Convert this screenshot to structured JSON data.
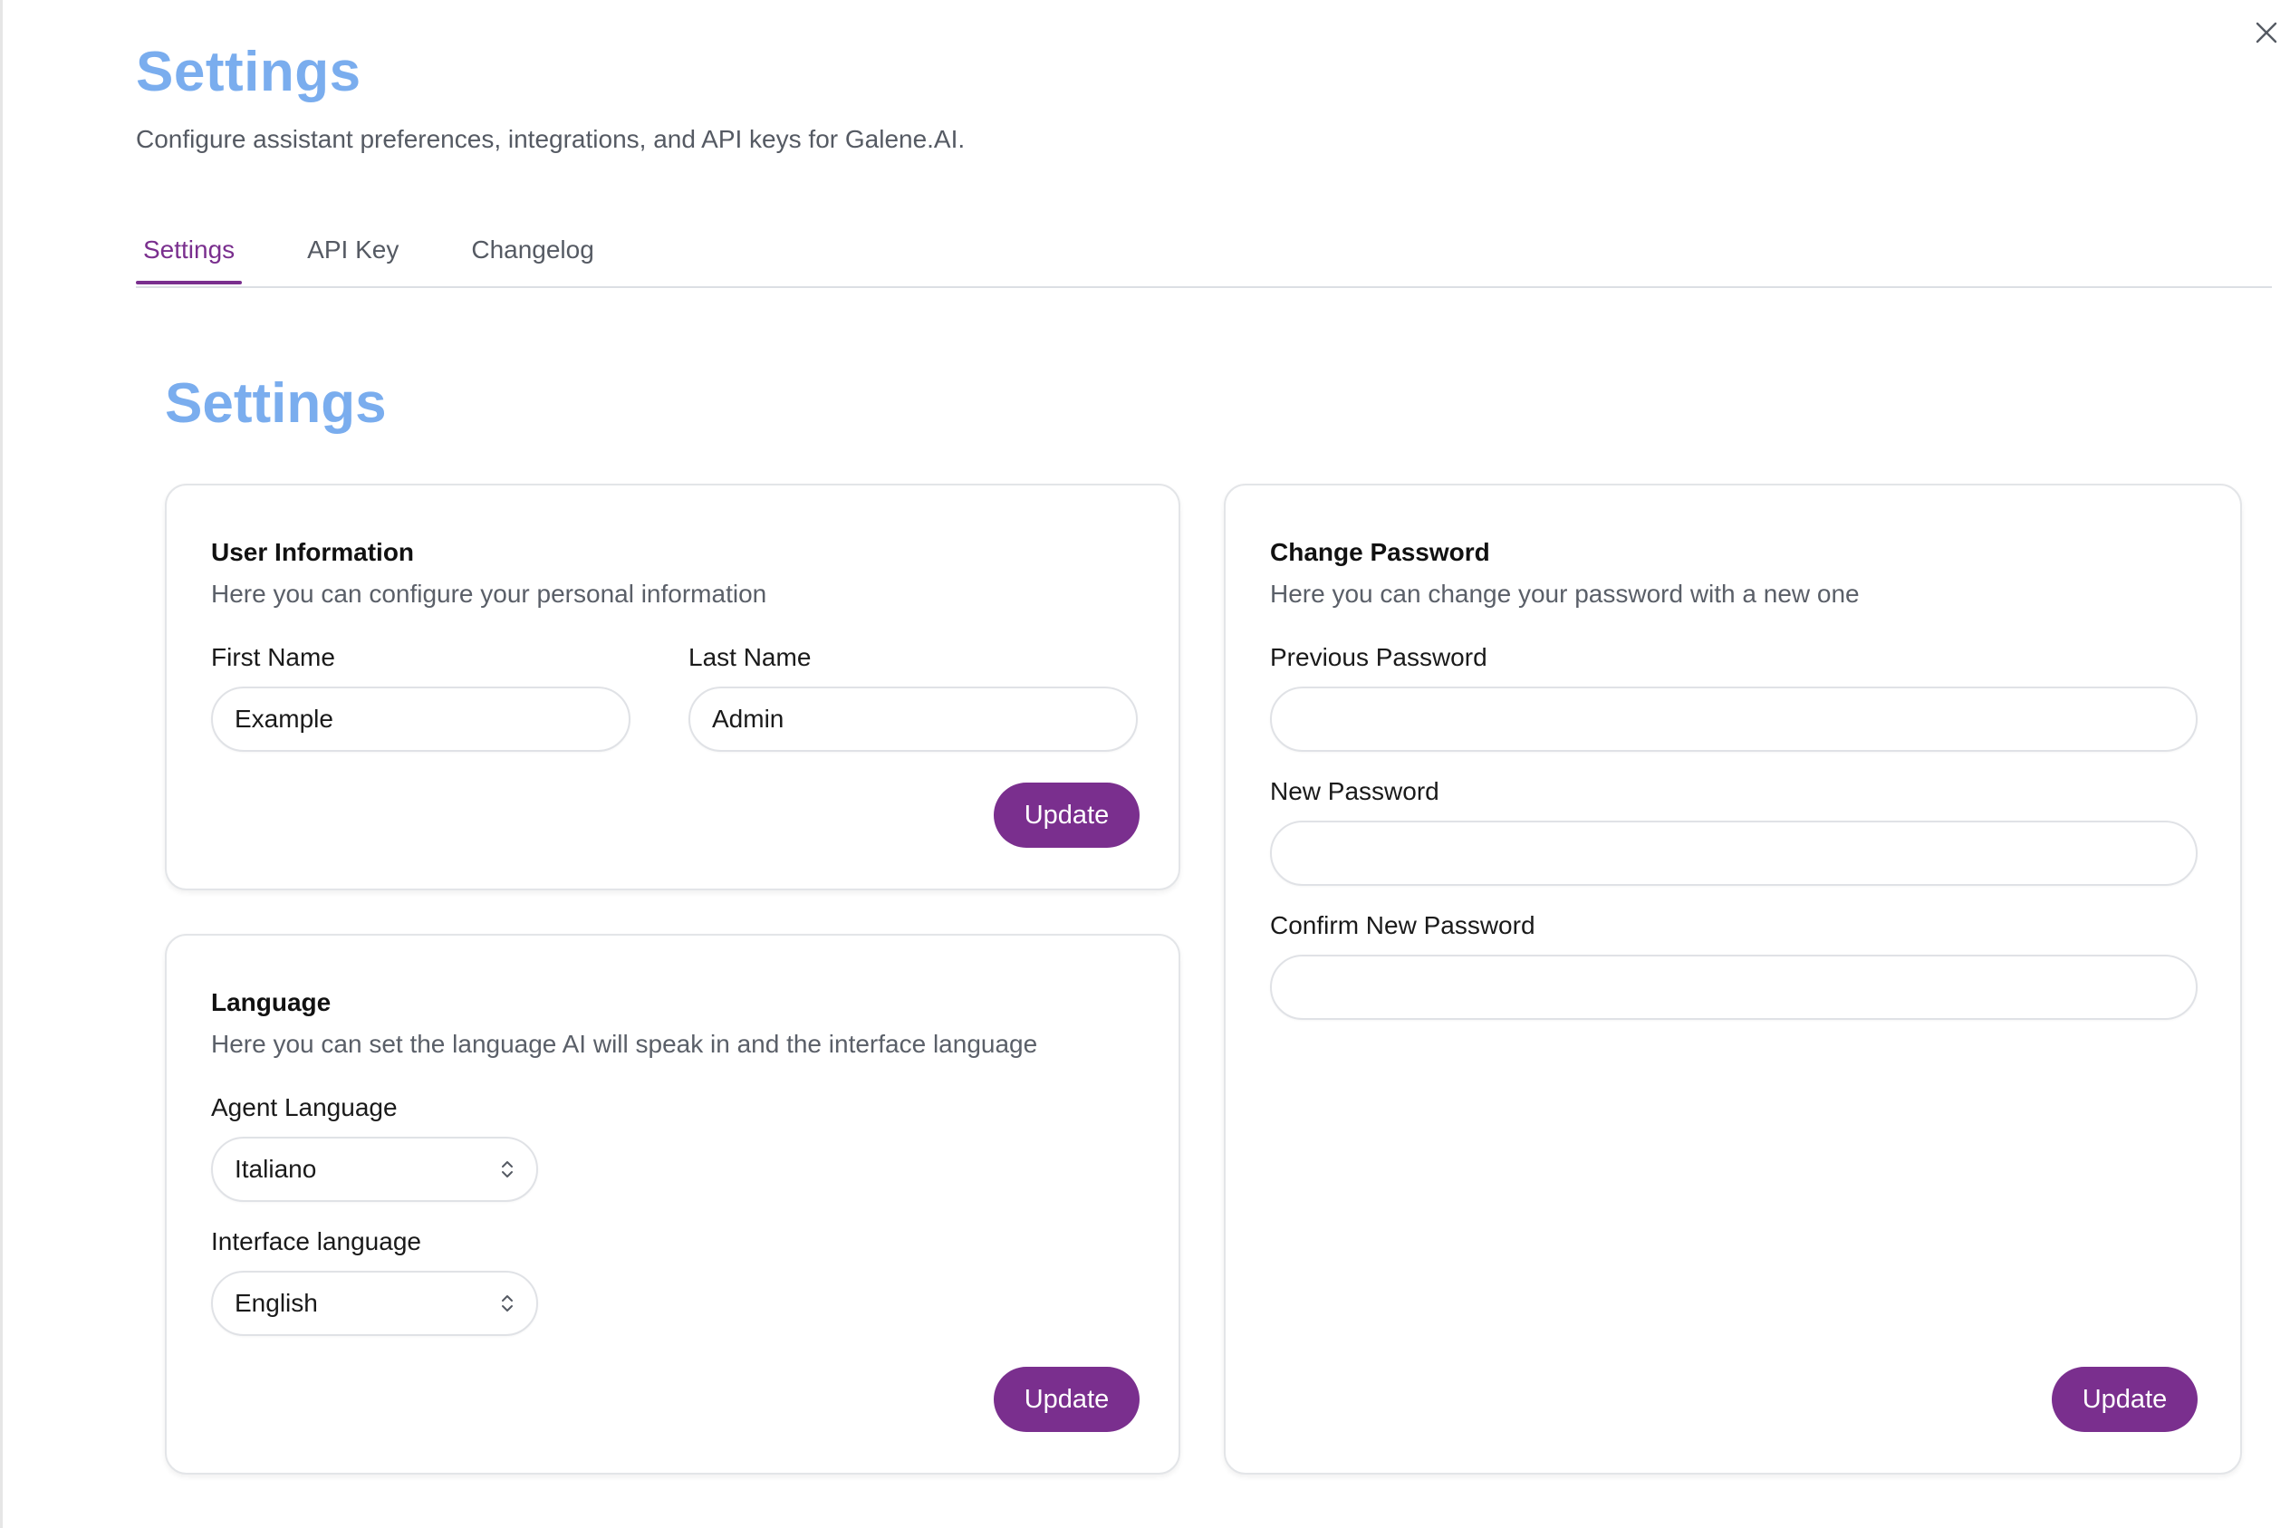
{
  "header": {
    "title": "Settings",
    "subtitle": "Configure assistant preferences, integrations, and API keys for Galene.AI."
  },
  "tabs": [
    {
      "label": "Settings",
      "active": true
    },
    {
      "label": "API Key",
      "active": false
    },
    {
      "label": "Changelog",
      "active": false
    }
  ],
  "section_title": "Settings",
  "user_info": {
    "heading": "User Information",
    "description": "Here you can configure your personal information",
    "first_name_label": "First Name",
    "first_name_value": "Example",
    "last_name_label": "Last Name",
    "last_name_value": "Admin",
    "update_label": "Update"
  },
  "language": {
    "heading": "Language",
    "description": "Here you can set the language AI will speak in and the interface language",
    "agent_language_label": "Agent Language",
    "agent_language_value": "Italiano",
    "interface_language_label": "Interface language",
    "interface_language_value": "English",
    "update_label": "Update"
  },
  "password": {
    "heading": "Change Password",
    "description": "Here you can change your password with a new one",
    "previous_label": "Previous Password",
    "previous_value": "",
    "new_label": "New Password",
    "new_value": "",
    "confirm_label": "Confirm New Password",
    "confirm_value": "",
    "update_label": "Update"
  },
  "icons": {
    "close": "close-icon",
    "select_chevron": "chevron-up-down-icon"
  },
  "colors": {
    "title": "#7aadee",
    "accent": "#7a2f8e",
    "muted_text": "#5a5f68",
    "border": "#e0e2e6"
  }
}
